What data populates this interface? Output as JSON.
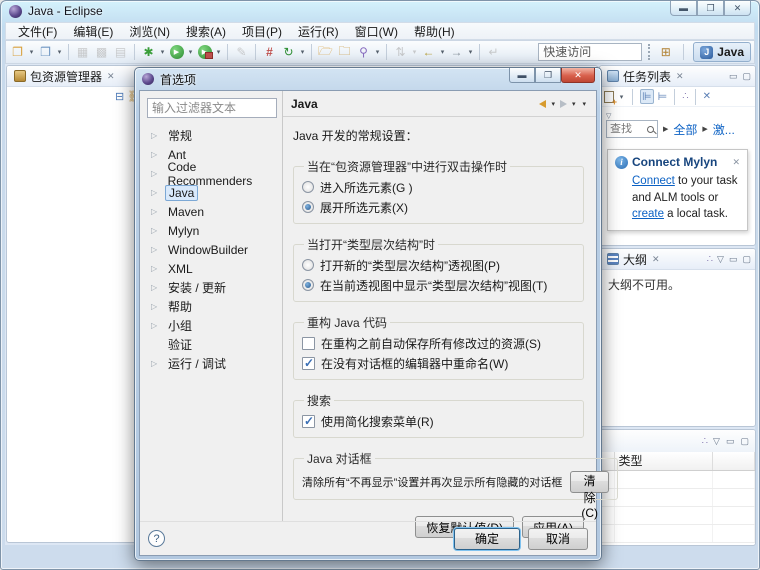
{
  "window": {
    "title": "Java  -  Eclipse",
    "menu": [
      "文件(F)",
      "编辑(E)",
      "浏览(N)",
      "搜索(A)",
      "项目(P)",
      "运行(R)",
      "窗口(W)",
      "帮助(H)"
    ],
    "quick_access_placeholder": "快速访问",
    "perspective_label": "Java"
  },
  "package_explorer": {
    "tab": "包资源管理器"
  },
  "task_list": {
    "tab": "任务列表",
    "find_placeholder": "查找",
    "link_all": "全部",
    "link_activated": "激...",
    "mylyn": {
      "title": "Connect Mylyn",
      "link_connect": "Connect",
      "text_after_connect": " to your task and ALM tools or ",
      "link_create": "create",
      "text_after_create": " a local task."
    }
  },
  "outline": {
    "tab": "大纲",
    "message": "大纲不可用。"
  },
  "problems": {
    "column_type": "类型"
  },
  "dialog": {
    "title": "首选项",
    "filter_placeholder": "输入过滤器文本",
    "tree": [
      {
        "label": "常规"
      },
      {
        "label": "Ant"
      },
      {
        "label": "Code Recommenders"
      },
      {
        "label": "Java",
        "selected": true
      },
      {
        "label": "Maven"
      },
      {
        "label": "Mylyn"
      },
      {
        "label": "WindowBuilder"
      },
      {
        "label": "XML"
      },
      {
        "label": "安装 / 更新"
      },
      {
        "label": "帮助"
      },
      {
        "label": "小组"
      },
      {
        "label": "验证",
        "expandable": false
      },
      {
        "label": "运行 / 调试"
      }
    ],
    "page": {
      "title": "Java",
      "description": "Java 开发的常规设置：",
      "group_double_click": {
        "title": "当在“包资源管理器”中进行双击操作时",
        "option_go_into": {
          "label": "进入所选元素(G )",
          "selected": false
        },
        "option_expand": {
          "label": "展开所选元素(X)",
          "selected": true
        }
      },
      "group_type_hierarchy": {
        "title": "当打开“类型层次结构”时",
        "option_new_perspective": {
          "label": "打开新的“类型层次结构”透视图(P)",
          "selected": false
        },
        "option_current_view": {
          "label": "在当前透视图中显示“类型层次结构”视图(T)",
          "selected": true
        }
      },
      "group_refactoring": {
        "title": "重构 Java 代码",
        "option_autosave": {
          "label": "在重构之前自动保存所有修改过的资源(S)",
          "checked": false
        },
        "option_rename_inline": {
          "label": "在没有对话框的编辑器中重命名(W)",
          "checked": true
        }
      },
      "group_search": {
        "title": "搜索",
        "option_simple_menu": {
          "label": "使用简化搜索菜单(R)",
          "checked": true
        }
      },
      "group_dialogs": {
        "title": "Java 对话框",
        "text": "清除所有“不再显示”设置并再次显示所有隐藏的对话框",
        "clear_button": "清除(C)"
      },
      "restore_button": "恢复默认值(D)",
      "apply_button": "应用(A)"
    },
    "help_button": "?",
    "ok_button": "确定",
    "cancel_button": "取消"
  }
}
